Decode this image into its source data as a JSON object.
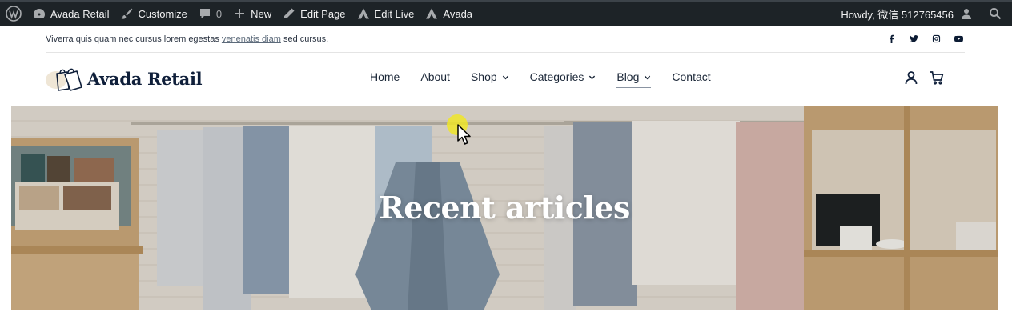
{
  "adminbar": {
    "site_name": "Avada Retail",
    "customize": "Customize",
    "comments_count": "0",
    "new": "New",
    "edit_page": "Edit Page",
    "edit_live": "Edit Live",
    "avada": "Avada",
    "howdy": "Howdy, 微信 512765456"
  },
  "topbar": {
    "promo_before": "Viverra quis quam nec cursus lorem egestas ",
    "promo_link": "venenatis diam",
    "promo_after": " sed cursus.",
    "socials": [
      "facebook-icon",
      "twitter-icon",
      "instagram-icon",
      "youtube-icon"
    ]
  },
  "header": {
    "logo_text": "Avada Retail",
    "nav": [
      {
        "label": "Home",
        "dropdown": false
      },
      {
        "label": "About",
        "dropdown": false
      },
      {
        "label": "Shop",
        "dropdown": true
      },
      {
        "label": "Categories",
        "dropdown": true
      },
      {
        "label": "Blog",
        "dropdown": true,
        "active": true
      },
      {
        "label": "Contact",
        "dropdown": false
      }
    ],
    "icons": [
      "account-icon",
      "cart-icon"
    ]
  },
  "hero": {
    "title": "Recent articles"
  },
  "colors": {
    "adminbar_bg": "#1d2327",
    "brand_navy": "#0f1f3a",
    "hero_title": "#ffffff"
  }
}
